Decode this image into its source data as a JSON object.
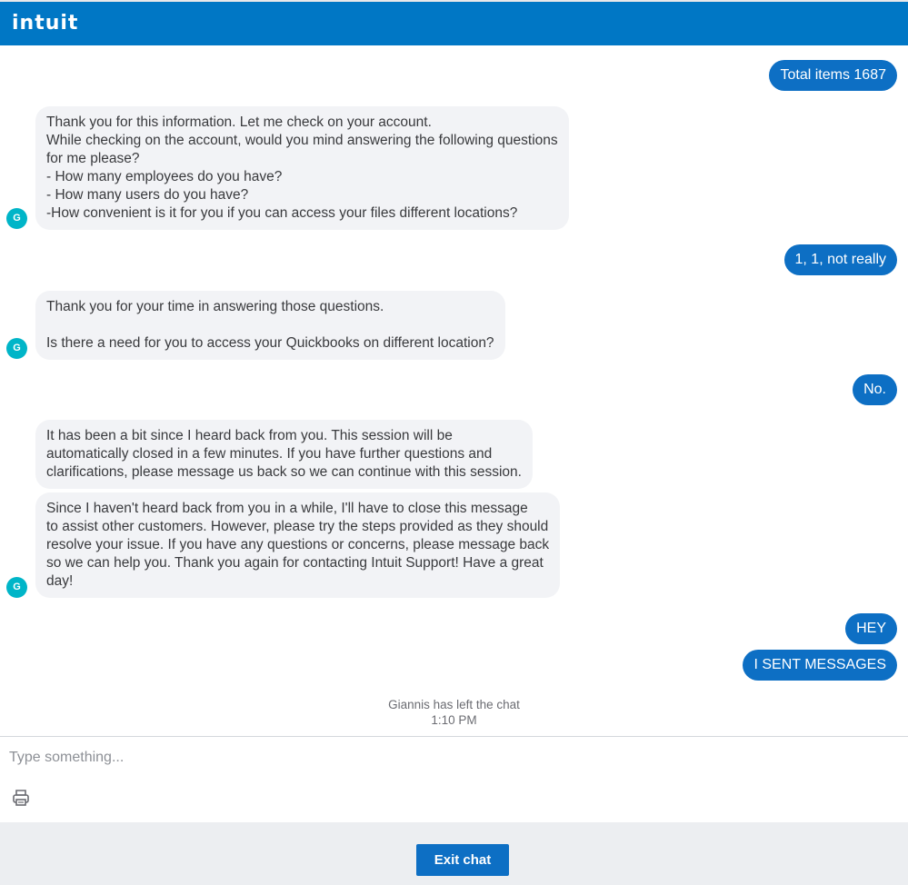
{
  "header": {
    "logo_text": "intuit"
  },
  "agent": {
    "avatar_initial": "G"
  },
  "messages": [
    {
      "sender": "user",
      "text": "Total items 1687"
    },
    {
      "sender": "agent",
      "text": "Thank you for this information. Let me check on your account.\nWhile checking on the account, would you mind answering the following questions\nfor me please?\n- How many employees do you have?\n- How many users do you have?\n-How convenient is it for you if you can access your files different locations?"
    },
    {
      "sender": "user",
      "text": "1, 1, not really"
    },
    {
      "sender": "agent",
      "text": "Thank you for your time in answering those questions.\n\nIs there a need for you to access your Quickbooks on different location?"
    },
    {
      "sender": "user",
      "text": "No."
    },
    {
      "sender": "agent",
      "text": "It has been a bit since I heard back from you. This session will be\nautomatically closed in a few minutes. If you have further questions and\nclarifications, please message us back so we can continue with this session."
    },
    {
      "sender": "agent",
      "text": "Since I haven't heard back from you in a while, I'll have to close this message\nto assist other customers. However, please try the steps provided as they should\nresolve your issue. If you have any questions or concerns, please message back\nso we can help you. Thank you again for contacting Intuit Support! Have a great\nday!"
    },
    {
      "sender": "user",
      "text": "HEY"
    },
    {
      "sender": "user",
      "text": "I SENT MESSAGES"
    }
  ],
  "system_notice": {
    "text": "Giannis has left the chat",
    "time": "1:10 PM"
  },
  "composer": {
    "placeholder": "Type something...",
    "value": "",
    "print_icon": "printer-icon"
  },
  "footer": {
    "exit_label": "Exit chat"
  },
  "colors": {
    "header": "#0077c5",
    "user_bubble": "#0d6fc4",
    "agent_bubble": "#f2f3f6",
    "avatar": "#00b5c8"
  }
}
